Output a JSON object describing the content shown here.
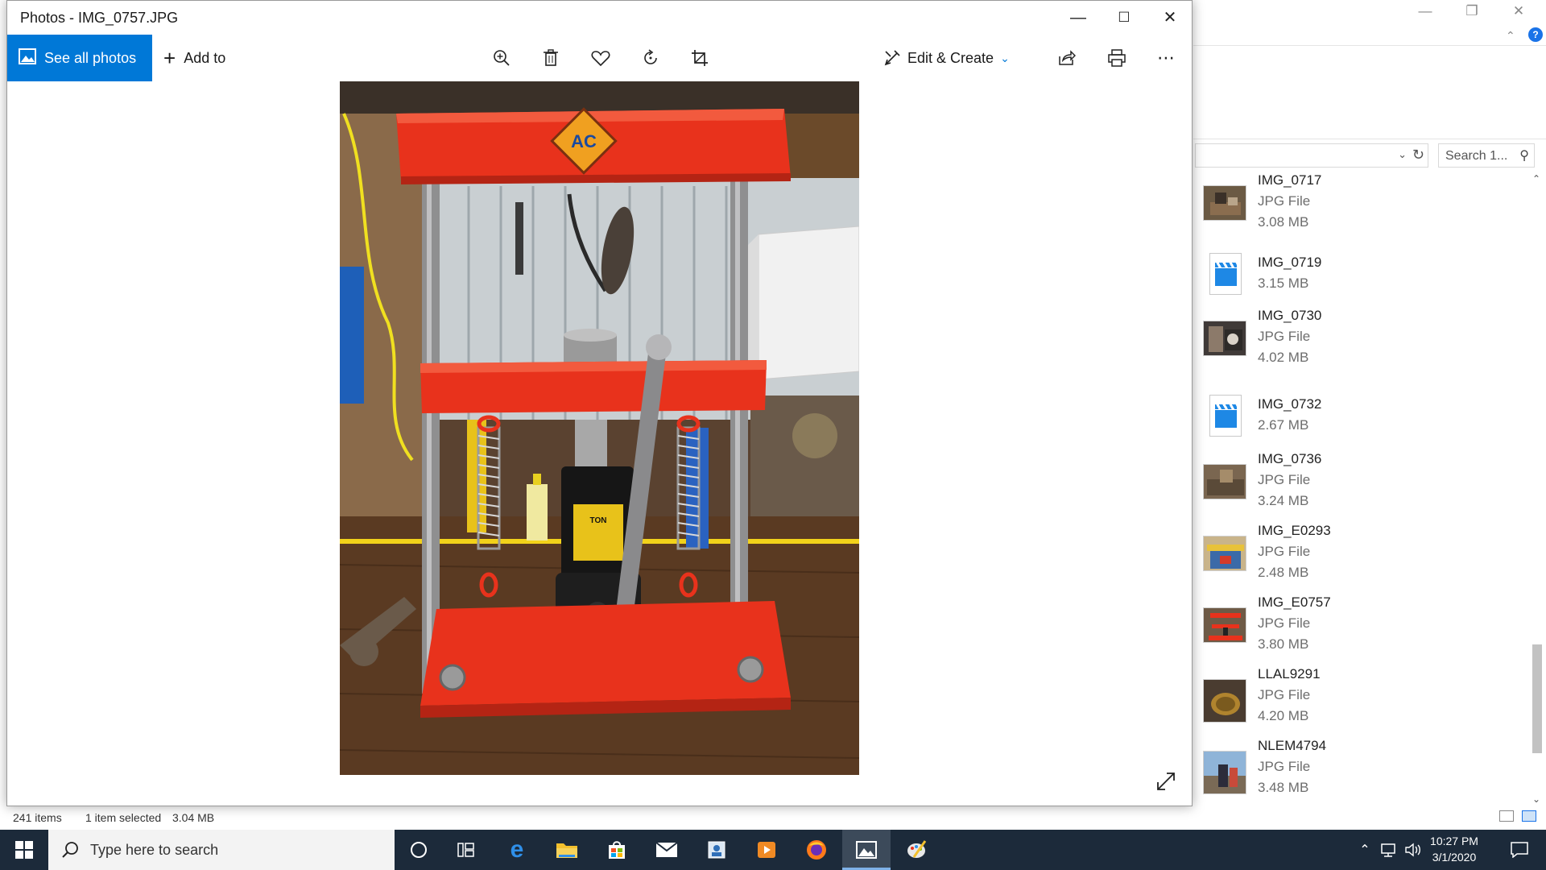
{
  "photos_window": {
    "title": "Photos - IMG_0757.JPG",
    "see_all_label": "See all photos",
    "add_to_label": "Add to",
    "edit_create_label": "Edit & Create"
  },
  "explorer": {
    "search_placeholder": "Search 1...",
    "files": [
      {
        "name": "IMG_0717",
        "type": "JPG File",
        "size": "3.08 MB",
        "kind": "image"
      },
      {
        "name": "IMG_0719",
        "type": "",
        "size": "3.15 MB",
        "kind": "video"
      },
      {
        "name": "IMG_0730",
        "type": "JPG File",
        "size": "4.02 MB",
        "kind": "image"
      },
      {
        "name": "IMG_0732",
        "type": "",
        "size": "2.67 MB",
        "kind": "video"
      },
      {
        "name": "IMG_0736",
        "type": "JPG File",
        "size": "3.24 MB",
        "kind": "image"
      },
      {
        "name": "IMG_E0293",
        "type": "JPG File",
        "size": "2.48 MB",
        "kind": "image"
      },
      {
        "name": "IMG_E0757",
        "type": "JPG File",
        "size": "3.80 MB",
        "kind": "image"
      },
      {
        "name": "LLAL9291",
        "type": "JPG File",
        "size": "4.20 MB",
        "kind": "image"
      },
      {
        "name": "NLEM4794",
        "type": "JPG File",
        "size": "3.48 MB",
        "kind": "image"
      }
    ],
    "status": {
      "item_count": "241 items",
      "selection": "1 item selected",
      "selection_size": "3.04 MB"
    }
  },
  "taskbar": {
    "search_placeholder": "Type here to search",
    "time": "10:27 PM",
    "date": "3/1/2020"
  },
  "colors": {
    "accent": "#0078d7",
    "taskbar": "#1c2a3a",
    "press_red": "#e8321c"
  }
}
